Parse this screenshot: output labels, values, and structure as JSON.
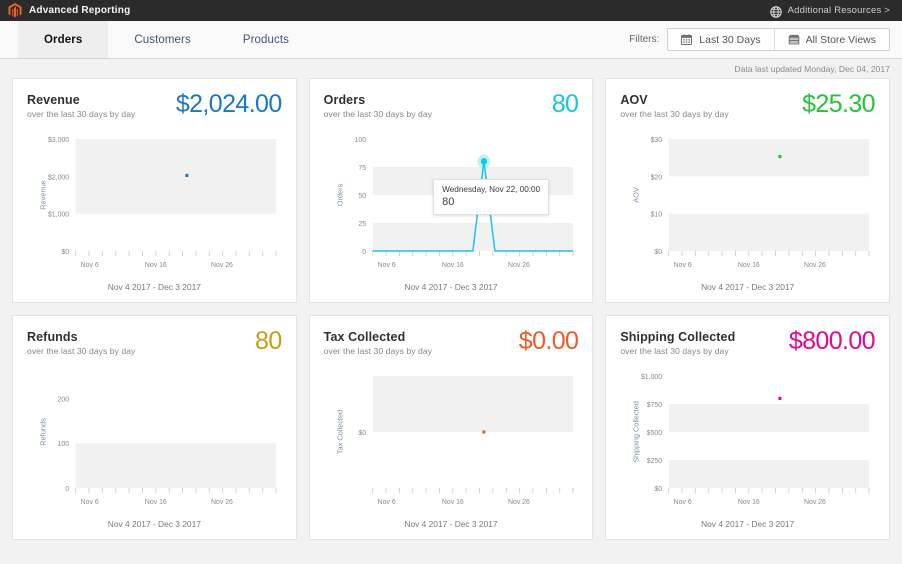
{
  "topbar": {
    "logo_icon": "magento-logo-icon",
    "brand_title": "Advanced Reporting",
    "globe_icon": "globe-icon",
    "additional_resources": "Additional Resources >",
    "logo_color": "#f26322",
    "background": "#2b2b2b"
  },
  "tabbar": {
    "tabs": [
      {
        "label": "Orders",
        "active": true
      },
      {
        "label": "Customers",
        "active": false
      },
      {
        "label": "Products",
        "active": false
      }
    ],
    "filters_label": "Filters:",
    "filter_buttons": [
      {
        "label": "Last 30 Days",
        "icon": "calendar-icon"
      },
      {
        "label": "All Store Views",
        "icon": "store-icon"
      }
    ]
  },
  "status": {
    "last_updated": "Data last updated Monday, Dec 04, 2017"
  },
  "chart_data": [
    {
      "id": "revenue",
      "type": "line",
      "title": "Revenue",
      "subtitle": "over the last 30 days by day",
      "value": "$2,024.00",
      "color": "#1979c3",
      "ylabel": "Revenue",
      "xlabel": "Nov 4 2017 - Dec 3 2017",
      "yticks": [
        "$3,000",
        "$2,000",
        "$1,000",
        "$0"
      ],
      "ytickvals": [
        3000,
        2000,
        1000,
        0
      ],
      "ylim": [
        0,
        3000
      ],
      "xticks": [
        "Nov 6",
        "Nov 16",
        "Nov 26"
      ],
      "xtickpos": [
        0.07,
        0.4,
        0.73
      ],
      "bands": [
        [
          1000,
          2000
        ],
        [
          2000,
          3000
        ]
      ],
      "points": [
        {
          "x": 0.555,
          "y": 2024
        }
      ],
      "grid": false,
      "legend": "none"
    },
    {
      "id": "orders",
      "type": "line",
      "title": "Orders",
      "subtitle": "over the last 30 days by day",
      "value": "80",
      "color": "#15c7e4",
      "ylabel": "Orders",
      "xlabel": "Nov 4 2017 - Dec 3 2017",
      "yticks": [
        "100",
        "75",
        "50",
        "25",
        "0"
      ],
      "ytickvals": [
        100,
        75,
        50,
        25,
        0
      ],
      "ylim": [
        0,
        100
      ],
      "xticks": [
        "Nov 6",
        "Nov 16",
        "Nov 26"
      ],
      "xtickpos": [
        0.07,
        0.4,
        0.73
      ],
      "bands": [
        [
          0,
          25
        ],
        [
          50,
          75
        ]
      ],
      "series": [
        {
          "name": "Orders",
          "x": [
            0.0,
            0.5,
            0.555,
            0.61,
            1.0
          ],
          "values": [
            0,
            0,
            80,
            0,
            0
          ]
        }
      ],
      "marker": {
        "x": 0.555,
        "y": 80
      },
      "tooltip": {
        "title": "Wednesday, Nov 22, 00:00",
        "value": "80"
      },
      "grid": false,
      "legend": "none"
    },
    {
      "id": "aov",
      "type": "line",
      "title": "AOV",
      "subtitle": "over the last 30 days by day",
      "value": "$25.30",
      "color": "#25c336",
      "ylabel": "AOV",
      "xlabel": "Nov 4 2017 - Dec 3 2017",
      "yticks": [
        "$30",
        "$20",
        "$10",
        "$0"
      ],
      "ytickvals": [
        30,
        20,
        10,
        0
      ],
      "ylim": [
        0,
        30
      ],
      "xticks": [
        "Nov 6",
        "Nov 16",
        "Nov 26"
      ],
      "xtickpos": [
        0.07,
        0.4,
        0.73
      ],
      "bands": [
        [
          0,
          10
        ],
        [
          20,
          30
        ]
      ],
      "points": [
        {
          "x": 0.555,
          "y": 25.3
        }
      ],
      "grid": false,
      "legend": "none"
    },
    {
      "id": "refunds",
      "type": "line",
      "title": "Refunds",
      "subtitle": "over the last 30 days by day",
      "value": "80",
      "color": "#cb9a13",
      "ylabel": "Refunds",
      "xlabel": "Nov 4 2017 - Dec 3 2017",
      "yticks": [
        "200",
        "100",
        "0"
      ],
      "ytickvals": [
        200,
        100,
        0
      ],
      "ylim": [
        0,
        250
      ],
      "xticks": [
        "Nov 6",
        "Nov 16",
        "Nov 26"
      ],
      "xtickpos": [
        0.07,
        0.4,
        0.73
      ],
      "bands": [
        [
          0,
          100
        ]
      ],
      "points": [],
      "grid": false,
      "legend": "none"
    },
    {
      "id": "tax",
      "type": "line",
      "title": "Tax Collected",
      "subtitle": "over the last 30 days by day",
      "value": "$0.00",
      "color": "#f1592a",
      "ylabel": "Tax Collected",
      "xlabel": "Nov 4 2017 - Dec 3 2017",
      "yticks": [
        "$0"
      ],
      "ytickvals": [
        0
      ],
      "ylim": [
        -1,
        1
      ],
      "xticks": [
        "Nov 6",
        "Nov 16",
        "Nov 26"
      ],
      "xtickpos": [
        0.07,
        0.4,
        0.73
      ],
      "bands": [
        [
          0,
          1
        ]
      ],
      "points": [
        {
          "x": 0.555,
          "y": 0
        }
      ],
      "grid": false,
      "legend": "none"
    },
    {
      "id": "shipping",
      "type": "line",
      "title": "Shipping Collected",
      "subtitle": "over the last 30 days by day",
      "value": "$800.00",
      "color": "#e5078f",
      "ylabel": "Shipping Collected",
      "xlabel": "Nov 4 2017 - Dec 3 2017",
      "yticks": [
        "$1,000",
        "$750",
        "$500",
        "$250",
        "$0"
      ],
      "ytickvals": [
        1000,
        750,
        500,
        250,
        0
      ],
      "ylim": [
        0,
        1000
      ],
      "xticks": [
        "Nov 6",
        "Nov 16",
        "Nov 26"
      ],
      "xtickpos": [
        0.07,
        0.4,
        0.73
      ],
      "bands": [
        [
          0,
          250
        ],
        [
          500,
          750
        ]
      ],
      "points": [
        {
          "x": 0.555,
          "y": 800
        }
      ],
      "grid": false,
      "legend": "none"
    }
  ]
}
